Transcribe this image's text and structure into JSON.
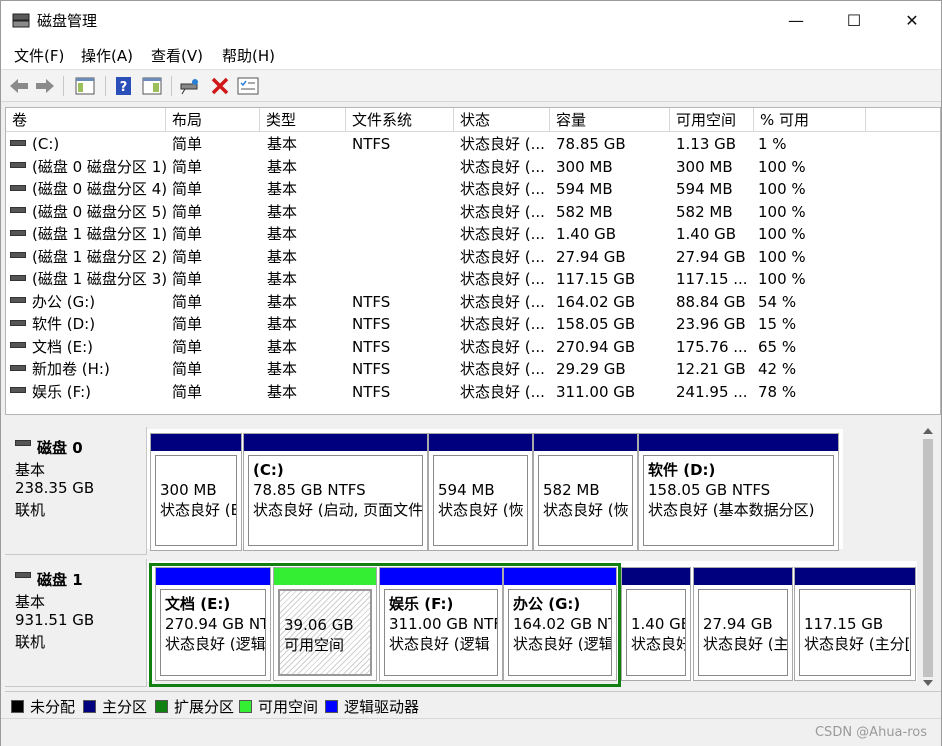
{
  "title": "磁盘管理",
  "window_controls": {
    "min": "—",
    "max": "☐",
    "close": "✕"
  },
  "menu": [
    "文件(F)",
    "操作(A)",
    "查看(V)",
    "帮助(H)"
  ],
  "toolbar_icons": [
    "back-arrow-icon",
    "forward-arrow-icon",
    "console-tree-icon",
    "help-icon",
    "properties-icon",
    "connect-icon",
    "delete-icon",
    "checklist-icon"
  ],
  "columns": [
    "卷",
    "布局",
    "类型",
    "文件系统",
    "状态",
    "容量",
    "可用空间",
    "% 可用"
  ],
  "volumes": [
    [
      "(C:)",
      "简单",
      "基本",
      "NTFS",
      "状态良好 (...",
      "78.85 GB",
      "1.13 GB",
      "1 %"
    ],
    [
      "(磁盘 0 磁盘分区 1)",
      "简单",
      "基本",
      "",
      "状态良好 (...",
      "300 MB",
      "300 MB",
      "100 %"
    ],
    [
      "(磁盘 0 磁盘分区 4)",
      "简单",
      "基本",
      "",
      "状态良好 (...",
      "594 MB",
      "594 MB",
      "100 %"
    ],
    [
      "(磁盘 0 磁盘分区 5)",
      "简单",
      "基本",
      "",
      "状态良好 (...",
      "582 MB",
      "582 MB",
      "100 %"
    ],
    [
      "(磁盘 1 磁盘分区 1)",
      "简单",
      "基本",
      "",
      "状态良好 (...",
      "1.40 GB",
      "1.40 GB",
      "100 %"
    ],
    [
      "(磁盘 1 磁盘分区 2)",
      "简单",
      "基本",
      "",
      "状态良好 (...",
      "27.94 GB",
      "27.94 GB",
      "100 %"
    ],
    [
      "(磁盘 1 磁盘分区 3)",
      "简单",
      "基本",
      "",
      "状态良好 (...",
      "117.15 GB",
      "117.15 ...",
      "100 %"
    ],
    [
      "办公 (G:)",
      "简单",
      "基本",
      "NTFS",
      "状态良好 (...",
      "164.02 GB",
      "88.84 GB",
      "54 %"
    ],
    [
      "软件 (D:)",
      "简单",
      "基本",
      "NTFS",
      "状态良好 (...",
      "158.05 GB",
      "23.96 GB",
      "15 %"
    ],
    [
      "文档 (E:)",
      "简单",
      "基本",
      "NTFS",
      "状态良好 (...",
      "270.94 GB",
      "175.76 ...",
      "65 %"
    ],
    [
      "新加卷 (H:)",
      "简单",
      "基本",
      "NTFS",
      "状态良好 (...",
      "29.29 GB",
      "12.21 GB",
      "42 %"
    ],
    [
      "娱乐 (F:)",
      "简单",
      "基本",
      "NTFS",
      "状态良好 (...",
      "311.00 GB",
      "241.95 ...",
      "78 %"
    ]
  ],
  "disks": [
    {
      "name": "磁盘 0",
      "type": "基本",
      "size": "238.35 GB",
      "status": "联机",
      "partitions": [
        {
          "label": "",
          "line1": "300 MB",
          "line2": "状态良好 (E",
          "kind": "primary"
        },
        {
          "label": "(C:)",
          "line1": "78.85 GB NTFS",
          "line2": "状态良好 (启动, 页面文件",
          "kind": "primary"
        },
        {
          "label": "",
          "line1": "594 MB",
          "line2": "状态良好 (恢",
          "kind": "primary"
        },
        {
          "label": "",
          "line1": "582 MB",
          "line2": "状态良好 (恢",
          "kind": "primary"
        },
        {
          "label": "软件 (D:)",
          "line1": "158.05 GB NTFS",
          "line2": "状态良好 (基本数据分区)",
          "kind": "primary"
        }
      ]
    },
    {
      "name": "磁盘 1",
      "type": "基本",
      "size": "931.51 GB",
      "status": "联机",
      "partitions": [
        {
          "label": "文档 (E:)",
          "line1": "270.94 GB NT",
          "line2": "状态良好 (逻辑",
          "kind": "logical"
        },
        {
          "label": "",
          "line1": "39.06 GB",
          "line2": "可用空间",
          "kind": "free"
        },
        {
          "label": "娱乐 (F:)",
          "line1": "311.00 GB NTF",
          "line2": "状态良好 (逻辑",
          "kind": "logical"
        },
        {
          "label": "办公 (G:)",
          "line1": "164.02 GB NT",
          "line2": "状态良好 (逻辑",
          "kind": "logical"
        },
        {
          "label": "",
          "line1": "1.40 GE",
          "line2": "状态良好",
          "kind": "primary"
        },
        {
          "label": "",
          "line1": "27.94 GB",
          "line2": "状态良好 (主",
          "kind": "primary"
        },
        {
          "label": "",
          "line1": "117.15 GB",
          "line2": "状态良好 (主分[",
          "kind": "primary"
        }
      ]
    }
  ],
  "legend": [
    {
      "label": "未分配",
      "color": "#000000"
    },
    {
      "label": "主分区",
      "color": "#00007f"
    },
    {
      "label": "扩展分区",
      "color": "#108010"
    },
    {
      "label": "可用空间",
      "color": "#33ee33"
    },
    {
      "label": "逻辑驱动器",
      "color": "#0000ff"
    }
  ],
  "colors": {
    "primary": "#00007f",
    "logical": "#0000ff",
    "free": "#33ee33",
    "extended": "#108010"
  },
  "watermark": "CSDN @Ahua-ros"
}
